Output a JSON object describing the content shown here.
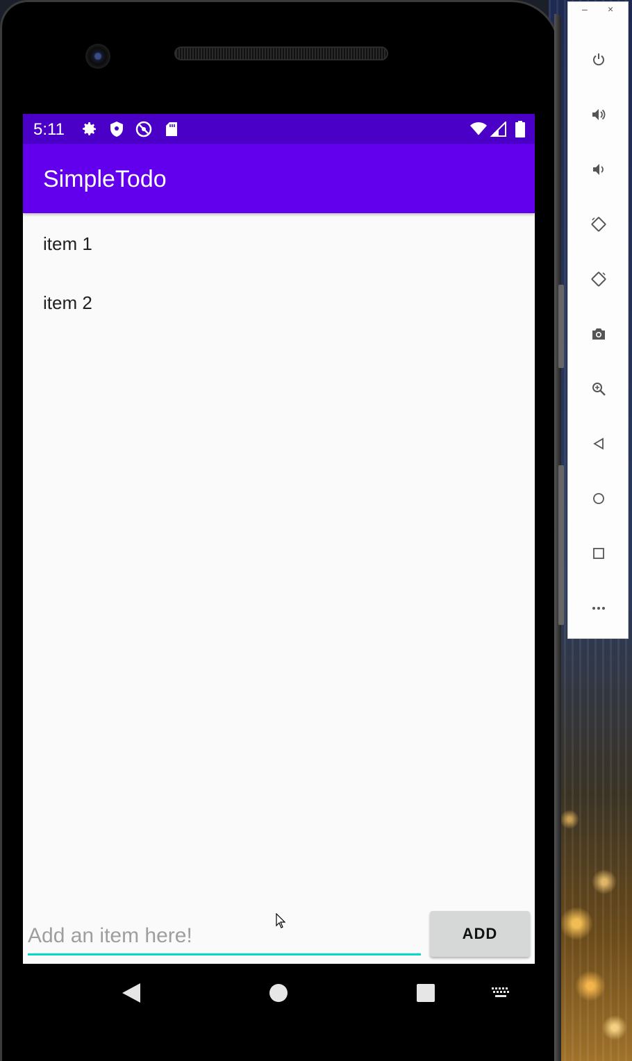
{
  "status_bar": {
    "time": "5:11",
    "left_icons": [
      "settings-icon",
      "shield-icon",
      "blocked-notification-icon",
      "sd-card-icon"
    ],
    "right_icons": [
      "wifi-icon",
      "cell-signal-icon",
      "battery-icon"
    ]
  },
  "app_bar": {
    "title": "SimpleTodo"
  },
  "todo_list": {
    "items": [
      {
        "label": "item 1"
      },
      {
        "label": "item 2"
      }
    ]
  },
  "input": {
    "placeholder": "Add an item here!",
    "value": ""
  },
  "add_button": {
    "label": "ADD"
  },
  "navigation": [
    "back-icon",
    "home-icon",
    "recents-icon",
    "keyboard-icon"
  ],
  "emulator_toolbar": {
    "window_controls": {
      "minimize": "–",
      "close": "×"
    },
    "tools": [
      "power-icon",
      "volume-up-icon",
      "volume-down-icon",
      "rotate-left-icon",
      "rotate-right-icon",
      "camera-icon",
      "zoom-icon",
      "back-icon",
      "home-icon",
      "overview-icon",
      "more-icon"
    ]
  },
  "colors": {
    "status_bar": "#4b00c7",
    "app_bar": "#6200ee",
    "accent": "#03dac5",
    "button": "#d6d7d7"
  }
}
